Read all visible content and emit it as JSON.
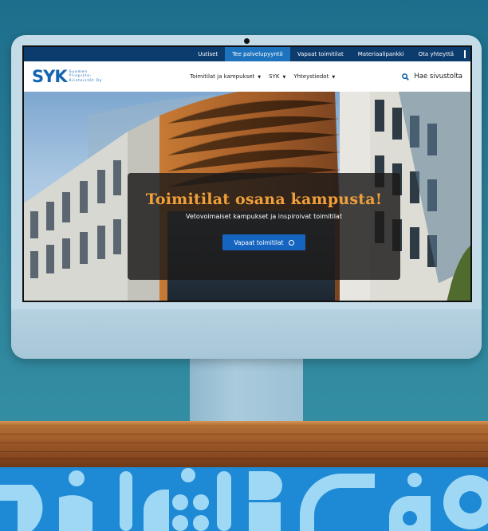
{
  "topbar": {
    "links": [
      {
        "label": "Uutiset",
        "active": false
      },
      {
        "label": "Tee palvelupyyntö",
        "active": true
      },
      {
        "label": "Vapaat toimitilat",
        "active": false
      },
      {
        "label": "Materiaalipankki",
        "active": false
      },
      {
        "label": "Ota yhteyttä",
        "active": false
      }
    ]
  },
  "logo": {
    "mark": "SYK",
    "lines": [
      "Suomen",
      "Yliopisto-",
      "Kiinteistöt Oy"
    ]
  },
  "nav": {
    "items": [
      {
        "label": "Toimitilat ja kampukset",
        "icon": "chevron-down-icon"
      },
      {
        "label": "SYK",
        "icon": "chevron-down-icon"
      },
      {
        "label": "Yhteystiedot",
        "icon": "chevron-down-icon"
      }
    ],
    "search_label": "Hae sivustolta",
    "search_icon": "search-icon"
  },
  "hero": {
    "title": "Toimitilat osana kampusta!",
    "subtitle": "Vetovoimaiset kampukset ja inspiroivat toimitilat",
    "cta_label": "Vapaat toimitilat",
    "cta_icon": "circle-icon"
  },
  "colors": {
    "topbar": "#0c3b6e",
    "active_link": "#1e73be",
    "brand": "#1565b0",
    "hero_title": "#f0a03a",
    "cta": "#1565c0"
  }
}
